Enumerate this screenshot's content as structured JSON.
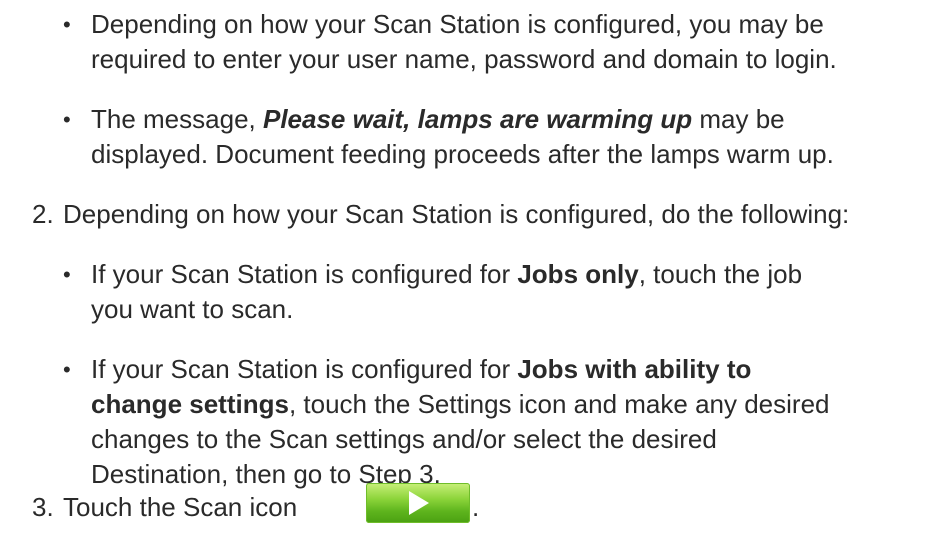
{
  "intro_bullets": [
    {
      "line1": "Depending on how your Scan Station is configured, you may be",
      "line2": "required to enter your user name, password and domain to login."
    },
    {
      "pre": "The message, ",
      "em": "Please wait, lamps are warming up",
      "post": " may be",
      "line2": "displayed. Document feeding proceeds after the lamps warm up."
    }
  ],
  "step2": {
    "number": "2.",
    "text": "Depending on how your Scan Station is configured, do the following:",
    "bullets": [
      {
        "pre": "If your Scan Station is configured for ",
        "em": "Jobs only",
        "post": ", touch the job",
        "line2": "you want to scan."
      },
      {
        "pre": "If your Scan Station is configured for ",
        "em": "Jobs with ability to",
        "line2_em": "change settings",
        "line2_post": ", touch the Settings icon and make any desired",
        "line3": "changes to the Scan settings and/or select the desired",
        "line4": "Destination, then go to Step 3."
      }
    ]
  },
  "step3": {
    "number": "3.",
    "text": "Touch the Scan icon",
    "after_icon": ".",
    "icon": "play-icon"
  },
  "bullet_glyph": "•"
}
